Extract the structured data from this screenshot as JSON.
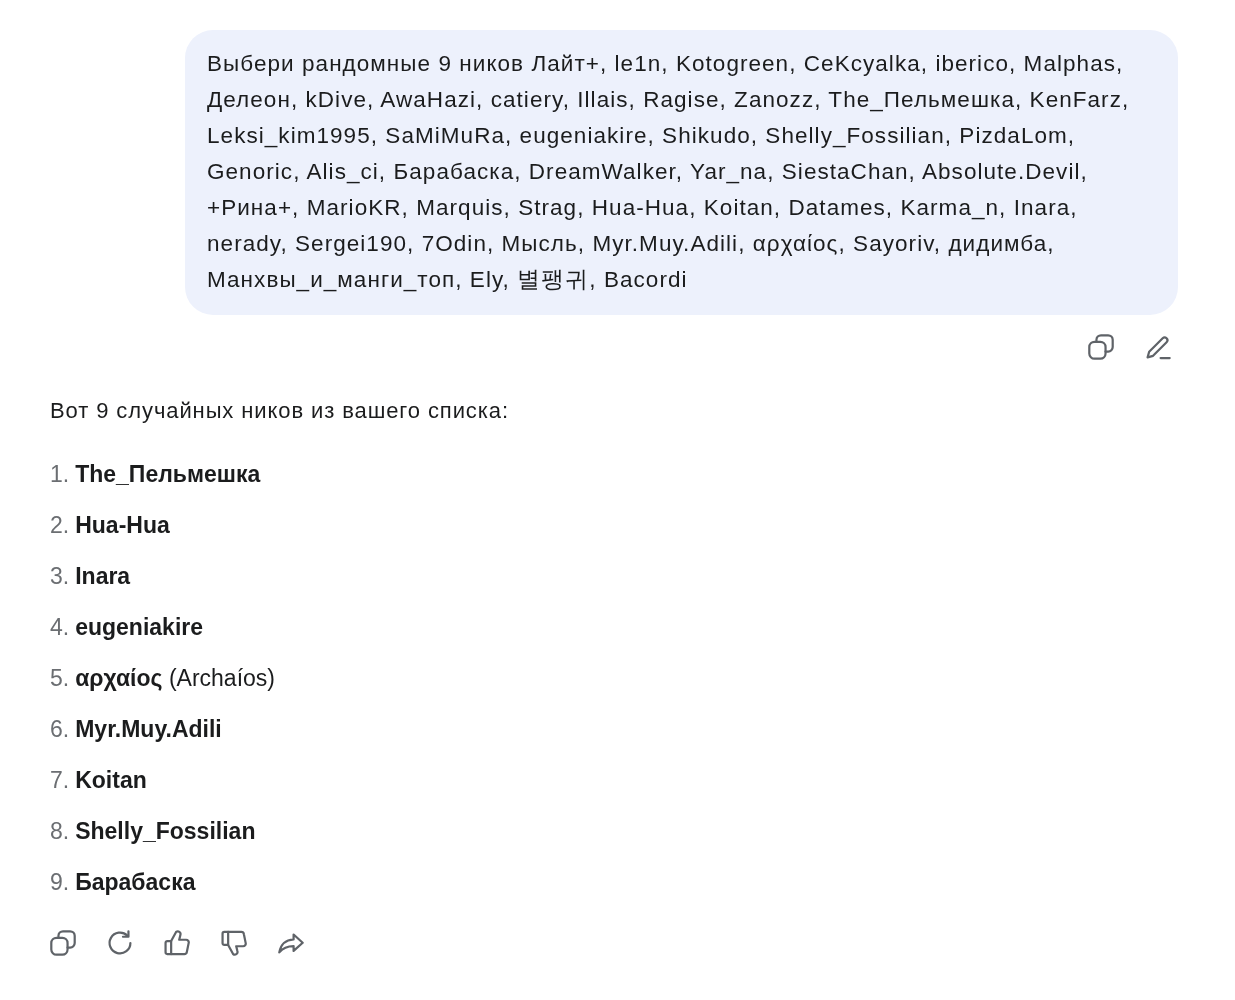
{
  "user_message": {
    "text": "Выбери рандомные 9 ников Лайт+, le1n, Kotogreen, CeKсyalka, iberico, Malphas, Делеон, kDive, AwaHazi, catiery, Illais, Ragise, Zanozz, The_Пельмешка, KenFarz, Leksi_kim1995, SaMiMuRa, eugeniakire, Shikudo, Shelly_Fossilian, PizdaLom, Genoric, Alis_ci, Барабаска, DreamWalker, Yar_na, SiestaChan, Absolute.Devil, +Рина+, MarioKR, Marquis, Strag, Hua-Hua, Koitan, Datames, Karma_n, Inara, nerady, Sergei190, 7Odin, Мысль, Myr.Muy.Adili, αρχαίος, Sayoriv, дидимба, Манхвы_и_манги_топ, Ely, 별팽귀, Bacordi"
  },
  "response": {
    "intro": "Вот 9 случайных ников из вашего списка:",
    "items": [
      {
        "number": "1.",
        "name": "The_Пельмешка"
      },
      {
        "number": "2.",
        "name": "Hua-Hua"
      },
      {
        "number": "3.",
        "name": "Inara"
      },
      {
        "number": "4.",
        "name": "eugeniakire"
      },
      {
        "number": "5.",
        "name": "αρχαίος",
        "note": "(Archaíos)"
      },
      {
        "number": "6.",
        "name": "Myr.Muy.Adili"
      },
      {
        "number": "7.",
        "name": "Koitan"
      },
      {
        "number": "8.",
        "name": "Shelly_Fossilian"
      },
      {
        "number": "9.",
        "name": "Барабаска"
      }
    ]
  }
}
